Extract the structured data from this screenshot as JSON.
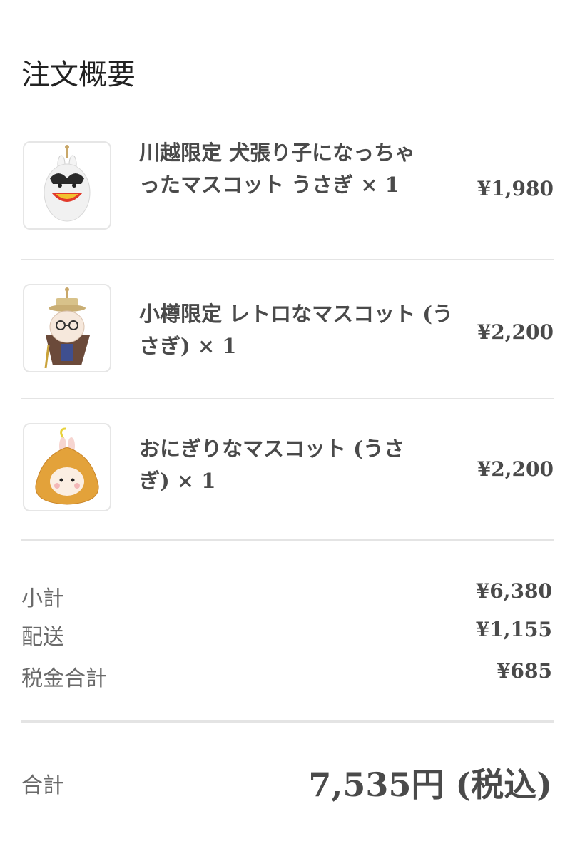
{
  "title": "注文概要",
  "items": [
    {
      "name": "川越限定 犬張り子になっちゃったマスコット うさぎ × 1",
      "price": "¥1,980",
      "image": "rabbit-dog-mascot-image"
    },
    {
      "name": "小樽限定 レトロなマスコット (うさぎ) × 1",
      "price": "¥2,200",
      "image": "retro-rabbit-mascot-image"
    },
    {
      "name": "おにぎりなマスコット (うさぎ) × 1",
      "price": "¥2,200",
      "image": "onigiri-rabbit-mascot-image"
    }
  ],
  "summary": {
    "subtotal_label": "小計",
    "subtotal": "¥6,380",
    "shipping_label": "配送",
    "shipping": "¥1,155",
    "tax_label": "税金合計",
    "tax": "¥685"
  },
  "total": {
    "label": "合計",
    "value": "7,535円 (税込)"
  }
}
